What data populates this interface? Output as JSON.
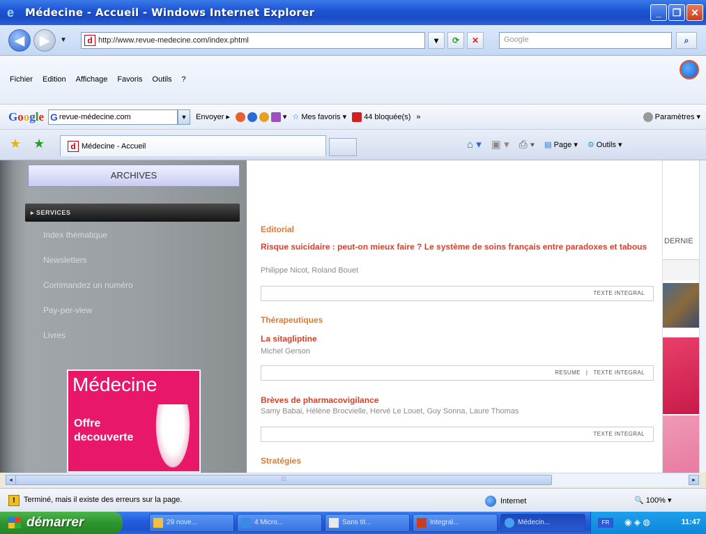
{
  "window": {
    "title": "Médecine - Accueil - Windows Internet Explorer"
  },
  "address": {
    "url": "http://www.revue-medecine.com/index.phtml",
    "search_placeholder": "Google"
  },
  "menu": [
    "Fichier",
    "Edition",
    "Affichage",
    "Favoris",
    "Outils",
    "?"
  ],
  "google_toolbar": {
    "site": "revue-médecine.com",
    "send": "Envoyer",
    "favorites": "Mes favoris",
    "blocked": "44 bloquée(s)",
    "more": "»",
    "settings": "Paramètres"
  },
  "tab": {
    "title": "Médecine - Accueil"
  },
  "command_bar": {
    "page": "Page",
    "tools": "Outils"
  },
  "sidebar": {
    "archives": "ARCHIVES",
    "services_header": "SERVICES",
    "items": [
      "Index thématique",
      "Newsletters",
      "Commandez un numéro",
      "Pay-per-view",
      "Livres"
    ],
    "promo": {
      "brand": "Médecine",
      "offer_line1": "Offre",
      "offer_line2": "decouverte"
    }
  },
  "main": {
    "sections": [
      {
        "heading": "Editorial",
        "title": "Risque suicidaire : peut-on mieux faire ? Le système de soins français entre paradoxes et tabous",
        "authors": "Philippe Nicot, Roland Bouet",
        "links": [
          "TEXTE INTEGRAL"
        ]
      },
      {
        "heading": "Thérapeutiques",
        "title": "La sitagliptine",
        "authors": "Michel Gerson",
        "links": [
          "RESUME",
          "TEXTE INTEGRAL"
        ]
      },
      {
        "heading": "",
        "title": "Brèves de pharmacovigilance",
        "authors": "Samy Babai, Hélène Brocvielle, Hervé Le Louet, Guy Sonna, Laure Thomas",
        "links": [
          "TEXTE INTEGRAL"
        ]
      },
      {
        "heading": "Stratégies",
        "title": "",
        "authors": "",
        "links": []
      }
    ]
  },
  "right_column": {
    "label": "DERNIE"
  },
  "status": {
    "message": "Terminé, mais il existe des erreurs sur la page.",
    "zone": "Internet",
    "zoom": "100%"
  },
  "taskbar": {
    "start": "démarrer",
    "tasks": [
      "29 nove...",
      "4 Micro...",
      "Sans tit...",
      "Integral...",
      "Médecin..."
    ],
    "lang": "FR",
    "clock": "11:47"
  },
  "colors": {
    "accent_orange": "#e07a30",
    "title_red": "#d8402a",
    "promo_pink": "#e8176a"
  }
}
